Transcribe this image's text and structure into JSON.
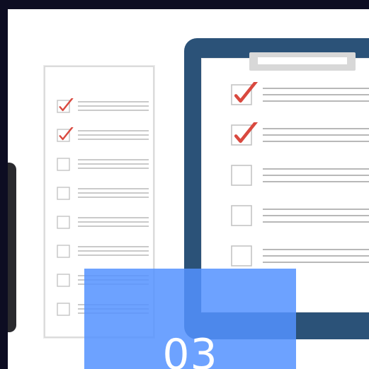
{
  "illustration": {
    "paper_checklist": {
      "items": [
        {
          "checked": true
        },
        {
          "checked": true
        },
        {
          "checked": false
        },
        {
          "checked": false
        },
        {
          "checked": false
        },
        {
          "checked": false
        },
        {
          "checked": false
        },
        {
          "checked": false
        }
      ]
    },
    "clipboard_checklist": {
      "items": [
        {
          "checked": true
        },
        {
          "checked": true
        },
        {
          "checked": false
        },
        {
          "checked": false
        },
        {
          "checked": false
        }
      ]
    }
  },
  "overlay": {
    "number": "03"
  },
  "colors": {
    "background": "#0d0d22",
    "clipboard_board": "#2b5278",
    "check_mark": "#d9493f",
    "overlay": "#5492ff"
  }
}
